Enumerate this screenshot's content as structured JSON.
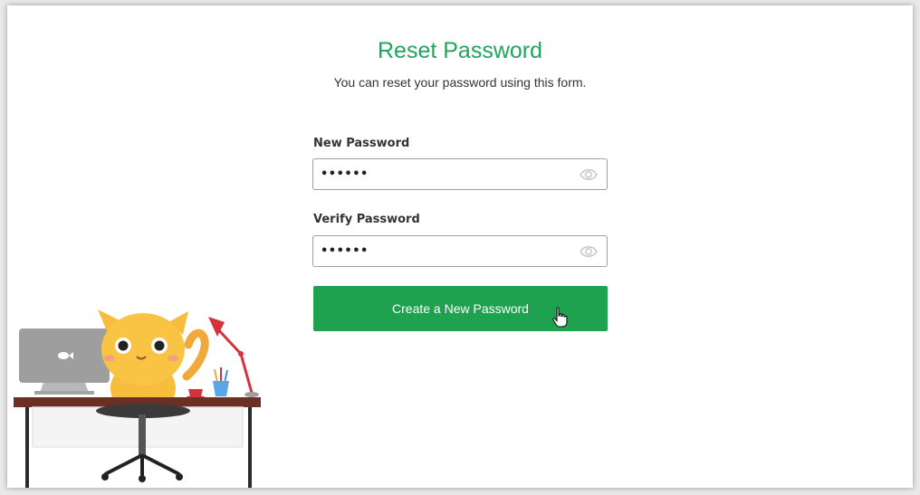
{
  "page": {
    "title": "Reset Password",
    "subtitle": "You can reset your password using this form."
  },
  "form": {
    "new_password": {
      "label": "New Password",
      "value": "••••••",
      "toggle_icon": "eye-icon"
    },
    "verify_password": {
      "label": "Verify Password",
      "value": "••••••",
      "toggle_icon": "eye-icon"
    },
    "submit_label": "Create a New Password"
  },
  "colors": {
    "accent": "#1fa55c",
    "button": "#1fa24f"
  },
  "illustration": {
    "subject": "cat-at-desk",
    "icons": [
      "laptop-icon",
      "fish-icon",
      "desk-lamp-icon",
      "pencil-cup-icon",
      "coffee-cup-icon",
      "office-chair-icon"
    ]
  }
}
